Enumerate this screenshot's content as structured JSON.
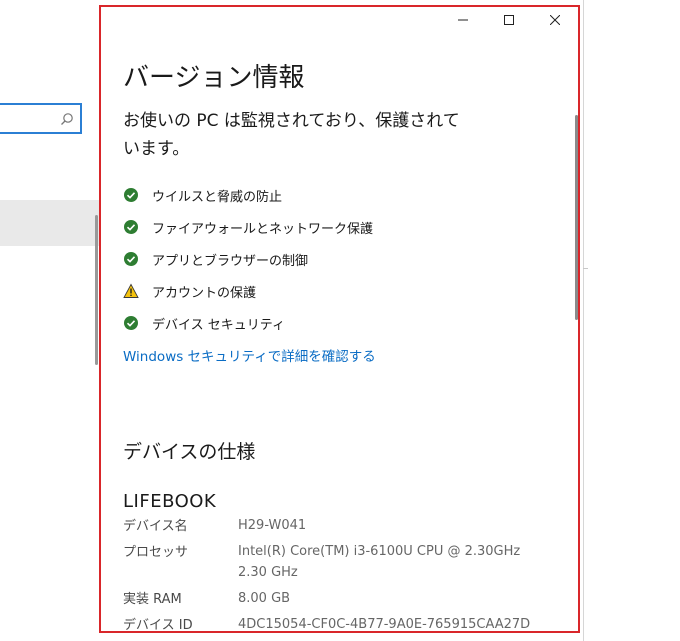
{
  "window": {
    "title": "バージョン情報",
    "controls": {
      "minimize": "minimize",
      "maximize": "maximize",
      "close": "close"
    }
  },
  "protection": {
    "message": "お使いの PC は監視されており、保護されています。",
    "items": [
      {
        "label": "ウイルスと脅威の防止",
        "status": "ok"
      },
      {
        "label": "ファイアウォールとネットワーク保護",
        "status": "ok"
      },
      {
        "label": "アプリとブラウザーの制御",
        "status": "ok"
      },
      {
        "label": "アカウントの保護",
        "status": "warning"
      },
      {
        "label": "デバイス セキュリティ",
        "status": "ok"
      }
    ],
    "link": "Windows セキュリティで詳細を確認する"
  },
  "device_spec": {
    "heading": "デバイスの仕様",
    "brand": "LIFEBOOK",
    "rows": [
      {
        "key": "デバイス名",
        "value": "H29-W041"
      },
      {
        "key": "プロセッサ",
        "value": "Intel(R) Core(TM) i3-6100U CPU @ 2.30GHz",
        "value2": "2.30 GHz"
      },
      {
        "key": "実装 RAM",
        "value": "8.00 GB"
      },
      {
        "key": "デバイス ID",
        "value": "4DC15054-CF0C-4B77-9A0E-765915CAA27D"
      }
    ]
  },
  "colors": {
    "accent_link": "#0a6cc4",
    "ok_green": "#2e7d32",
    "warning_yellow": "#f4c20d",
    "highlight_border": "#d9262a"
  },
  "icons": {
    "ok": "check-circle-icon",
    "warning": "warning-triangle-icon",
    "search": "search-icon"
  }
}
